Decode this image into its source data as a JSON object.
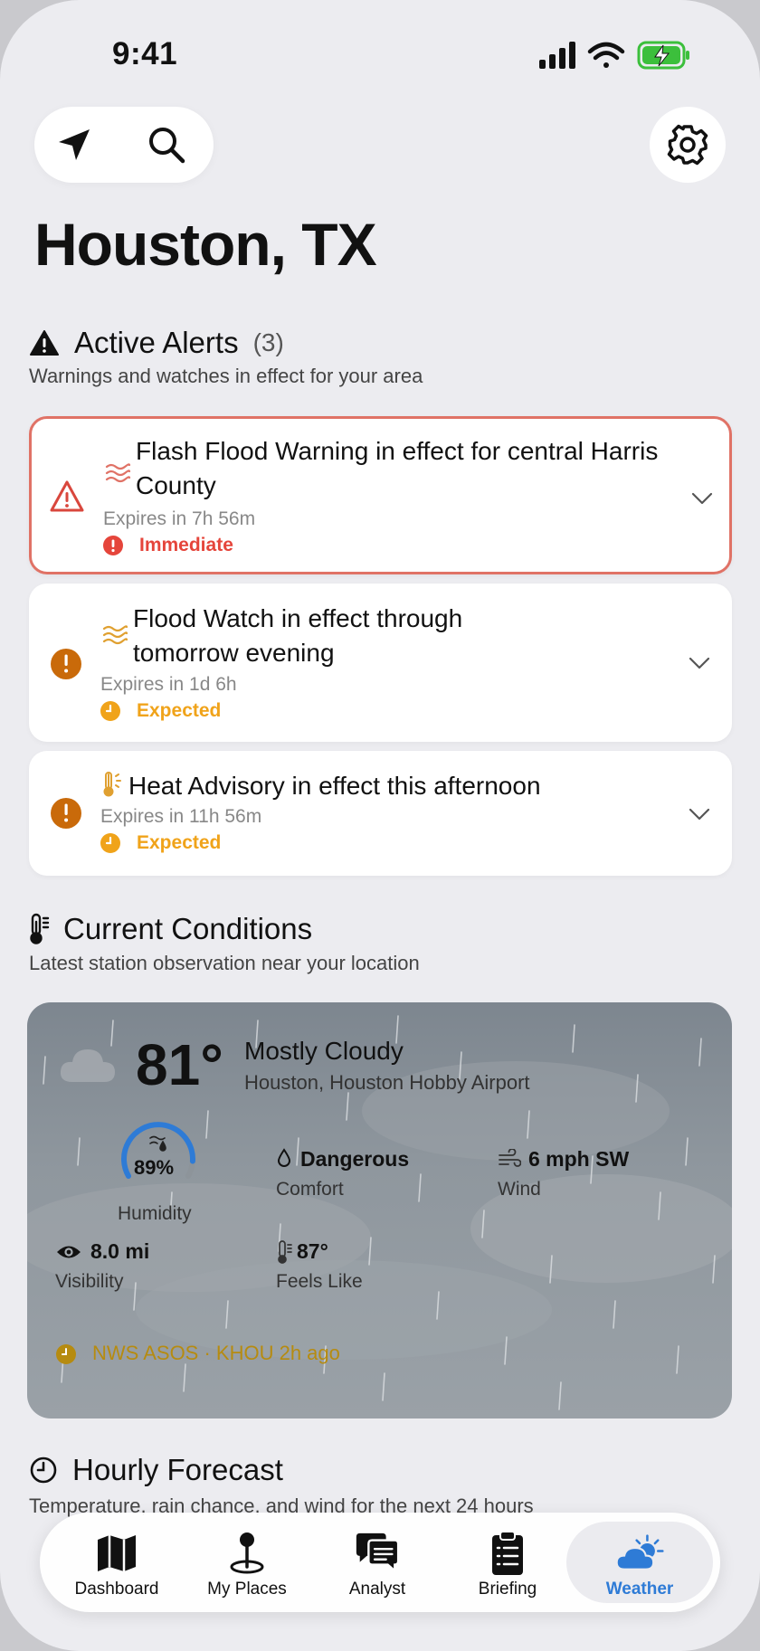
{
  "status_bar": {
    "time": "9:41"
  },
  "header": {
    "city": "Houston, TX"
  },
  "alerts_section": {
    "title": "Active Alerts",
    "count": "(3)",
    "subtitle": "Warnings and watches in effect for your area"
  },
  "alerts": [
    {
      "title": "Flash Flood Warning in effect for central Harris County",
      "expires": "Expires in 7h 56m",
      "severity": "Immediate",
      "icon": "flood-waves-icon",
      "color": "#e5453b"
    },
    {
      "title": "Flood Watch in effect through tomorrow evening",
      "expires": "Expires in 1d 6h",
      "severity": "Expected",
      "icon": "flood-waves-icon",
      "color": "#f0a31a"
    },
    {
      "title": "Heat Advisory in effect this afternoon",
      "expires": "Expires in 11h 56m",
      "severity": "Expected",
      "icon": "heat-thermometer-icon",
      "color": "#f0a31a"
    }
  ],
  "conditions_section": {
    "title": "Current Conditions",
    "subtitle": "Latest station observation near your location"
  },
  "current": {
    "temperature": "81°",
    "condition": "Mostly Cloudy",
    "station": "Houston, Houston Hobby Airport",
    "humidity": {
      "value": "89%",
      "label": "Humidity",
      "level": 0.89
    },
    "comfort": {
      "value": "Dangerous",
      "label": "Comfort"
    },
    "wind": {
      "value": "6 mph SW",
      "label": "Wind"
    },
    "visibility": {
      "value": "8.0 mi",
      "label": "Visibility"
    },
    "feels_like": {
      "value": "87°",
      "label": "Feels Like"
    },
    "source": "NWS ASOS · KHOU 2h ago"
  },
  "hourly_section": {
    "title": "Hourly Forecast",
    "subtitle": "Temperature, rain chance, and wind for the next 24 hours"
  },
  "tabbar": {
    "items": [
      {
        "label": "Dashboard",
        "icon": "map-icon"
      },
      {
        "label": "My Places",
        "icon": "pin-icon"
      },
      {
        "label": "Analyst",
        "icon": "chat-bubbles-icon"
      },
      {
        "label": "Briefing",
        "icon": "clipboard-icon"
      },
      {
        "label": "Weather",
        "icon": "partly-cloudy-icon"
      }
    ],
    "active": "Weather",
    "active_color": "#2e7bd6"
  },
  "colors": {
    "accent": "#2e7bd6",
    "danger": "#e5453b",
    "warning": "#f0a31a",
    "warning_icon": "#c96a0a"
  }
}
